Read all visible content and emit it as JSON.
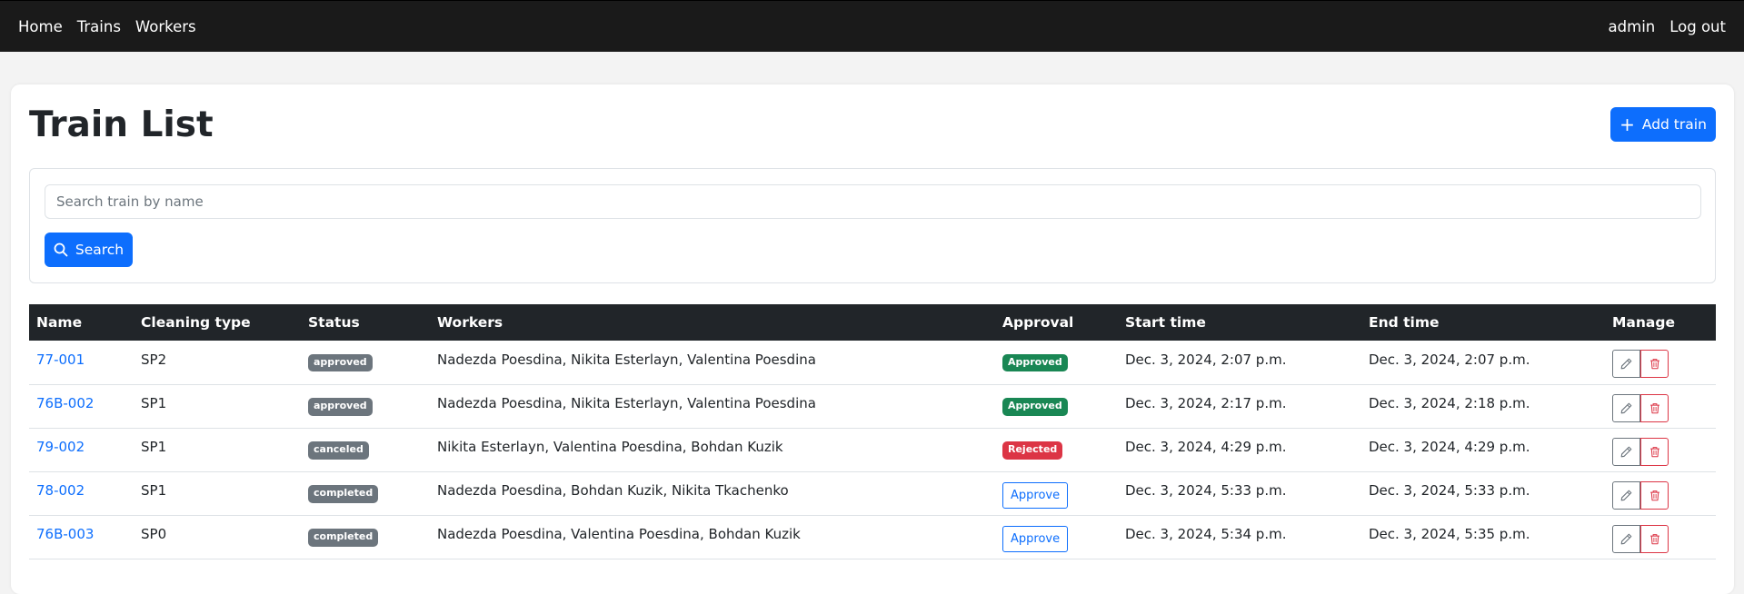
{
  "nav": {
    "left": [
      "Home",
      "Trains",
      "Workers"
    ],
    "user": "admin",
    "logout": "Log out"
  },
  "page": {
    "title": "Train List",
    "add_button": "Add train"
  },
  "search": {
    "placeholder": "Search train by name",
    "value": "",
    "button": "Search"
  },
  "table": {
    "headers": [
      "Name",
      "Cleaning type",
      "Status",
      "Workers",
      "Approval",
      "Start time",
      "End time",
      "Manage"
    ],
    "rows": [
      {
        "name": "77-001",
        "cleaning_type": "SP2",
        "status": "approved",
        "workers": "Nadezda Poesdina, Nikita Esterlayn, Valentina Poesdina",
        "approval": "Approved",
        "approval_kind": "success",
        "start": "Dec. 3, 2024, 2:07 p.m.",
        "end": "Dec. 3, 2024, 2:07 p.m."
      },
      {
        "name": "76B-002",
        "cleaning_type": "SP1",
        "status": "approved",
        "workers": "Nadezda Poesdina, Nikita Esterlayn, Valentina Poesdina",
        "approval": "Approved",
        "approval_kind": "success",
        "start": "Dec. 3, 2024, 2:17 p.m.",
        "end": "Dec. 3, 2024, 2:18 p.m."
      },
      {
        "name": "79-002",
        "cleaning_type": "SP1",
        "status": "canceled",
        "workers": "Nikita Esterlayn, Valentina Poesdina, Bohdan Kuzik",
        "approval": "Rejected",
        "approval_kind": "danger",
        "start": "Dec. 3, 2024, 4:29 p.m.",
        "end": "Dec. 3, 2024, 4:29 p.m."
      },
      {
        "name": "78-002",
        "cleaning_type": "SP1",
        "status": "completed",
        "workers": "Nadezda Poesdina, Bohdan Kuzik, Nikita Tkachenko",
        "approval": "Approve",
        "approval_kind": "button",
        "start": "Dec. 3, 2024, 5:33 p.m.",
        "end": "Dec. 3, 2024, 5:33 p.m."
      },
      {
        "name": "76B-003",
        "cleaning_type": "SP0",
        "status": "completed",
        "workers": "Nadezda Poesdina, Valentina Poesdina, Bohdan Kuzik",
        "approval": "Approve",
        "approval_kind": "button",
        "start": "Dec. 3, 2024, 5:34 p.m.",
        "end": "Dec. 3, 2024, 5:35 p.m."
      }
    ]
  },
  "colors": {
    "navbar": "#1a1a1a",
    "primary": "#0d6efd",
    "success": "#198754",
    "danger": "#dc3545",
    "secondary": "#6c757d",
    "table_header": "#212529"
  },
  "icons": {
    "add": "plus-icon",
    "search": "search-icon",
    "edit": "pencil-icon",
    "delete": "trash-icon"
  }
}
